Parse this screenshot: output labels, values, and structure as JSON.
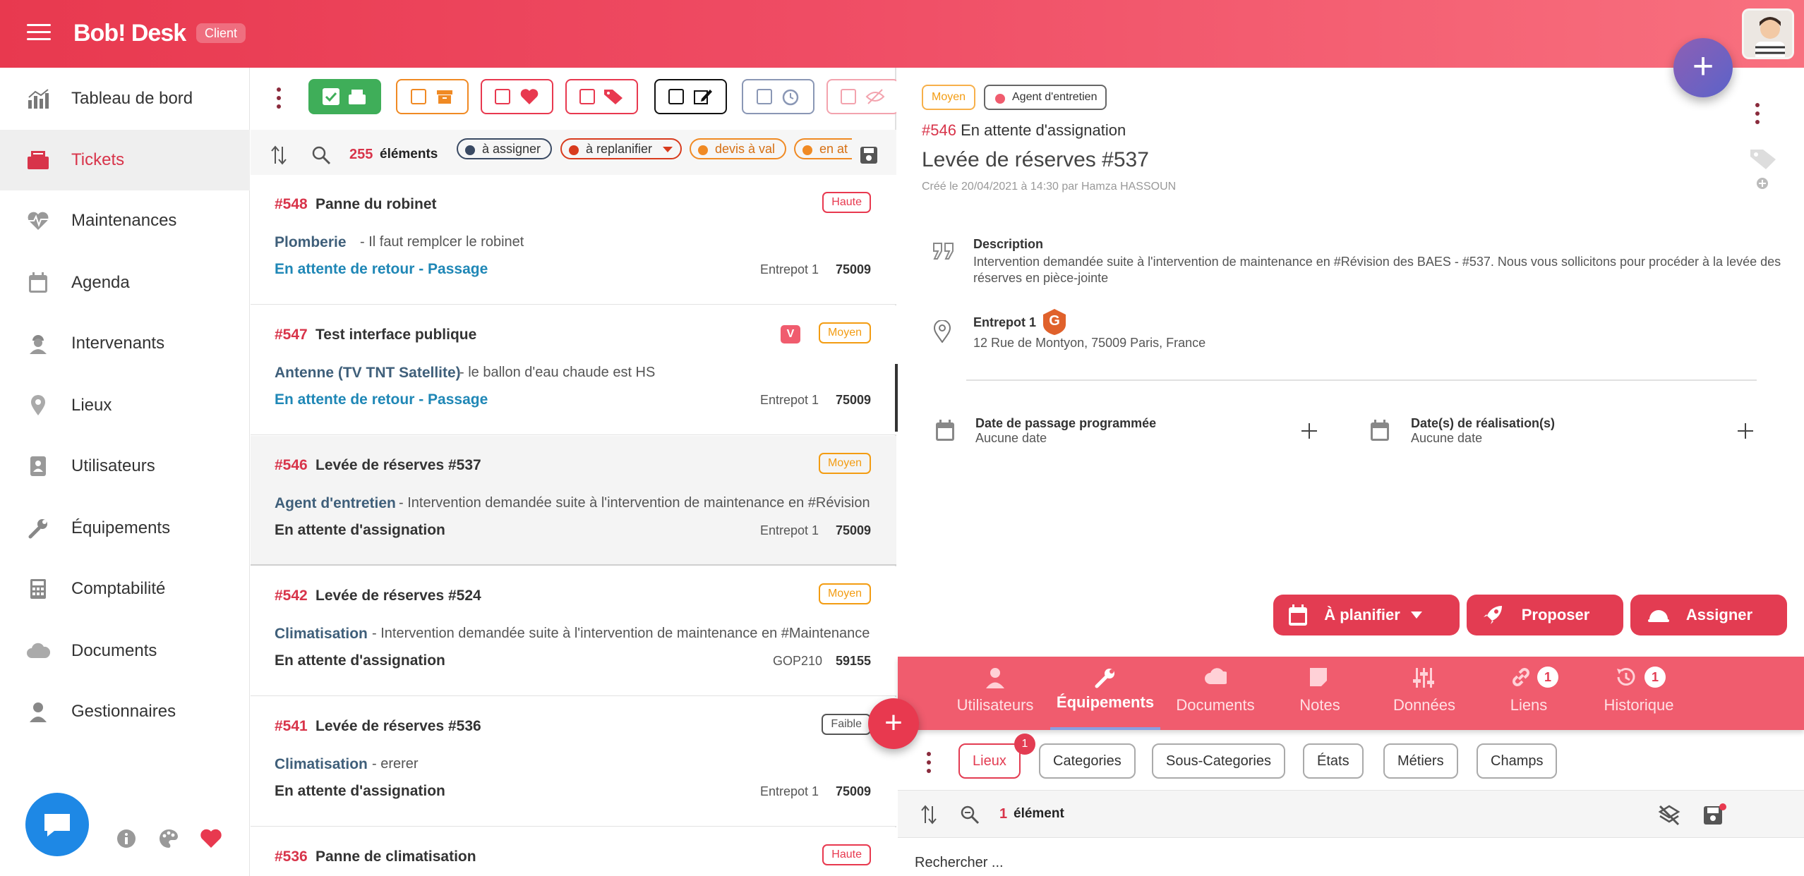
{
  "app": {
    "name": "Bob! Desk",
    "role_badge": "Client"
  },
  "colors": {
    "primary": "#e8394f",
    "status_blue": "#1f87b6",
    "badge_high": "#e8394f",
    "badge_medium": "#f39c12",
    "badge_low": "#555555"
  },
  "sidebar": {
    "items": [
      {
        "label": "Tableau de bord",
        "icon": "chart-icon"
      },
      {
        "label": "Tickets",
        "icon": "inbox-icon",
        "active": true
      },
      {
        "label": "Maintenances",
        "icon": "heartbeat-icon"
      },
      {
        "label": "Agenda",
        "icon": "calendar-icon"
      },
      {
        "label": "Intervenants",
        "icon": "worker-icon"
      },
      {
        "label": "Lieux",
        "icon": "map-pin-icon"
      },
      {
        "label": "Utilisateurs",
        "icon": "contacts-icon"
      },
      {
        "label": "Équipements",
        "icon": "wrench-icon"
      },
      {
        "label": "Comptabilité",
        "icon": "calculator-icon"
      },
      {
        "label": "Documents",
        "icon": "cloud-icon"
      },
      {
        "label": "Gestionnaires",
        "icon": "manager-icon"
      }
    ]
  },
  "list": {
    "count": "255",
    "count_label": "éléments",
    "chips": [
      {
        "label": "à assigner",
        "color": "#3a4a63"
      },
      {
        "label": "à replanifier",
        "color": "#d83b1d"
      },
      {
        "label": "devis à val",
        "color": "#f08a24"
      },
      {
        "label": "en at",
        "color": "#f08a24"
      }
    ],
    "tickets": [
      {
        "num": "#548",
        "title": "Panne du robinet",
        "badge": "Haute",
        "cat": "Plomberie",
        "desc": "- Il faut remplcer le robinet",
        "status": "En attente de retour - Passage",
        "loc": "Entrepot 1",
        "zip": "75009"
      },
      {
        "num": "#547",
        "title": "Test interface publique",
        "badge": "Moyen",
        "v": "V",
        "cat": "Antenne (TV TNT Satellite)",
        "desc": "- le ballon d'eau chaude est HS",
        "status": "En attente de retour - Passage",
        "loc": "Entrepot 1",
        "zip": "75009"
      },
      {
        "num": "#546",
        "title": "Levée de réserves #537",
        "badge": "Moyen",
        "cat": "Agent d'entretien",
        "desc": "- Intervention demandée suite à l'intervention de maintenance en #Révision",
        "status": "En attente d'assignation",
        "loc": "Entrepot 1",
        "zip": "75009"
      },
      {
        "num": "#542",
        "title": "Levée de réserves #524",
        "badge": "Moyen",
        "cat": "Climatisation",
        "desc": "- Intervention demandée suite à l'intervention de maintenance en #Maintenance",
        "status": "En attente d'assignation",
        "loc": "GOP210",
        "zip": "59155"
      },
      {
        "num": "#541",
        "title": "Levée de réserves #536",
        "badge": "Faible",
        "cat": "Climatisation",
        "desc": "- ererer",
        "status": "En attente d'assignation",
        "loc": "Entrepot 1",
        "zip": "75009"
      },
      {
        "num": "#536",
        "title": "Panne de climatisation",
        "badge": "Haute"
      }
    ]
  },
  "detail": {
    "tag_priority": "Moyen",
    "tag_category": "Agent d'entretien",
    "num": "#546",
    "state": "En attente d'assignation",
    "title": "Levée de réserves #537",
    "meta": "Créé le 20/04/2021 à 14:30 par Hamza HASSOUN",
    "description_label": "Description",
    "description": "Intervention demandée suite à l'intervention de maintenance en #Révision des BAES - #537. Nous vous sollicitons pour procéder à la levée des réserves en pièce-jointe",
    "place_name": "Entrepot 1",
    "place_badge": "G",
    "address": "12 Rue de Montyon, 75009 Paris, France",
    "date_planned_label": "Date de passage programmée",
    "date_planned_value": "Aucune date",
    "date_done_label": "Date(s) de réalisation(s)",
    "date_done_value": "Aucune date",
    "actions": {
      "plan": "À planifier",
      "propose": "Proposer",
      "assign": "Assigner"
    },
    "tabs": [
      {
        "label": "Utilisateurs",
        "icon": "user-icon"
      },
      {
        "label": "Équipements",
        "icon": "wrench-icon",
        "active": true
      },
      {
        "label": "Documents",
        "icon": "cloud-icon"
      },
      {
        "label": "Notes",
        "icon": "note-icon"
      },
      {
        "label": "Données",
        "icon": "sliders-icon"
      },
      {
        "label": "Liens",
        "icon": "link-icon",
        "count": "1"
      },
      {
        "label": "Historique",
        "icon": "history-icon",
        "count": "1"
      }
    ],
    "subtabs": [
      {
        "label": "Lieux",
        "active": true,
        "count": "1"
      },
      {
        "label": "Categories"
      },
      {
        "label": "Sous-Categories"
      },
      {
        "label": "États"
      },
      {
        "label": "Métiers"
      },
      {
        "label": "Champs"
      }
    ],
    "sub_count": "1",
    "sub_count_label": "élément",
    "search_placeholder": "Rechercher ..."
  }
}
